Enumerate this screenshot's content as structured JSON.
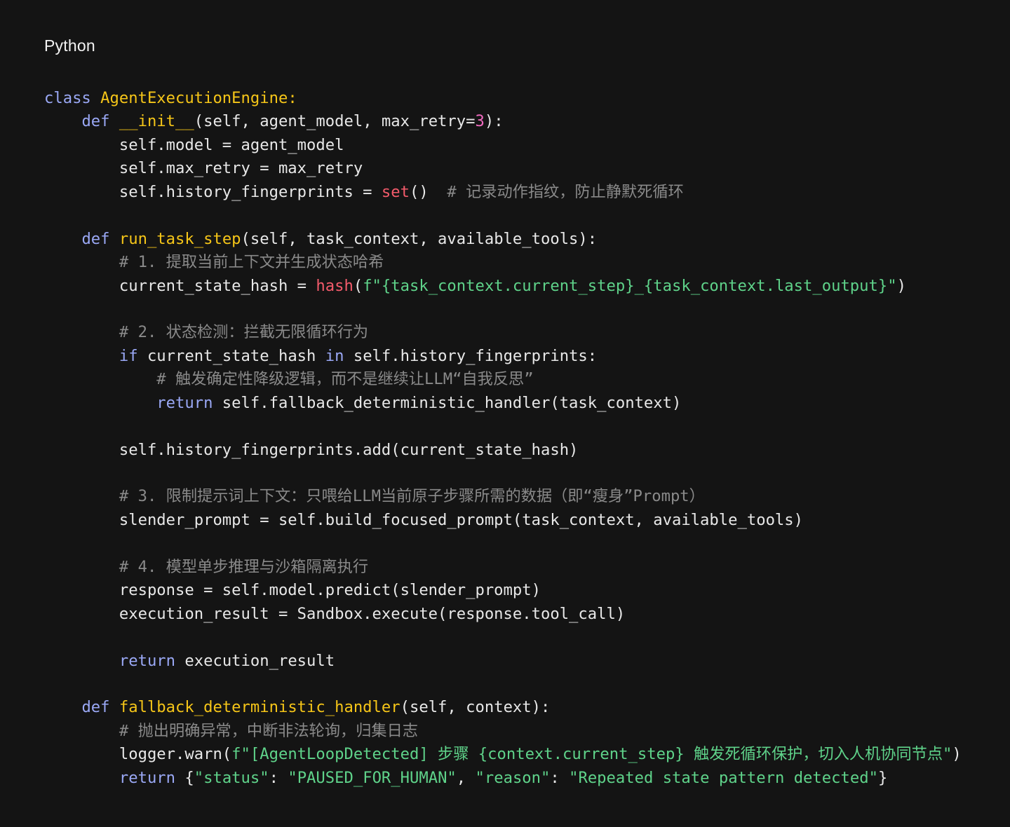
{
  "language_label": "Python",
  "colors": {
    "background": "#141414",
    "keyword": "#9aa8f5",
    "function_name": "#f5c518",
    "number": "#f06abf",
    "builtin": "#f35b6b",
    "string": "#5fd38a",
    "comment": "#8a8a8a",
    "text": "#e8e8e8"
  },
  "code_lines": [
    [
      [
        "kw",
        "class"
      ],
      [
        "plain",
        " "
      ],
      [
        "fn",
        "AgentExecutionEngine:"
      ]
    ],
    [
      [
        "plain",
        "    "
      ],
      [
        "kw",
        "def"
      ],
      [
        "plain",
        " "
      ],
      [
        "fn",
        "__init__"
      ],
      [
        "plain",
        "(self, agent_model, max_retry="
      ],
      [
        "num",
        "3"
      ],
      [
        "plain",
        "):"
      ]
    ],
    [
      [
        "plain",
        "        self.model = agent_model"
      ]
    ],
    [
      [
        "plain",
        "        self.max_retry = max_retry"
      ]
    ],
    [
      [
        "plain",
        "        self.history_fingerprints = "
      ],
      [
        "builtin",
        "set"
      ],
      [
        "plain",
        "()  "
      ],
      [
        "cm",
        "# 记录动作指纹，防止静默死循环"
      ]
    ],
    [],
    [
      [
        "plain",
        "    "
      ],
      [
        "kw",
        "def"
      ],
      [
        "plain",
        " "
      ],
      [
        "fn",
        "run_task_step"
      ],
      [
        "plain",
        "(self, task_context, available_tools):"
      ]
    ],
    [
      [
        "plain",
        "        "
      ],
      [
        "cm",
        "# 1. 提取当前上下文并生成状态哈希"
      ]
    ],
    [
      [
        "plain",
        "        current_state_hash = "
      ],
      [
        "builtin",
        "hash"
      ],
      [
        "plain",
        "("
      ],
      [
        "str",
        "f\"{task_context.current_step}_{task_context.last_output}\""
      ],
      [
        "plain",
        ")"
      ]
    ],
    [],
    [
      [
        "plain",
        "        "
      ],
      [
        "cm",
        "# 2. 状态检测：拦截无限循环行为"
      ]
    ],
    [
      [
        "plain",
        "        "
      ],
      [
        "kw",
        "if"
      ],
      [
        "plain",
        " current_state_hash "
      ],
      [
        "kw",
        "in"
      ],
      [
        "plain",
        " self.history_fingerprints:"
      ]
    ],
    [
      [
        "plain",
        "            "
      ],
      [
        "cm",
        "# 触发确定性降级逻辑，而不是继续让LLM“自我反思”"
      ]
    ],
    [
      [
        "plain",
        "            "
      ],
      [
        "kw",
        "return"
      ],
      [
        "plain",
        " self.fallback_deterministic_handler(task_context)"
      ]
    ],
    [],
    [
      [
        "plain",
        "        self.history_fingerprints.add(current_state_hash)"
      ]
    ],
    [],
    [
      [
        "plain",
        "        "
      ],
      [
        "cm",
        "# 3. 限制提示词上下文：只喂给LLM当前原子步骤所需的数据（即“瘦身”Prompt）"
      ]
    ],
    [
      [
        "plain",
        "        slender_prompt = self.build_focused_prompt(task_context, available_tools)"
      ]
    ],
    [],
    [
      [
        "plain",
        "        "
      ],
      [
        "cm",
        "# 4. 模型单步推理与沙箱隔离执行"
      ]
    ],
    [
      [
        "plain",
        "        response = self.model.predict(slender_prompt)"
      ]
    ],
    [
      [
        "plain",
        "        execution_result = Sandbox.execute(response.tool_call)"
      ]
    ],
    [],
    [
      [
        "plain",
        "        "
      ],
      [
        "kw",
        "return"
      ],
      [
        "plain",
        " execution_result"
      ]
    ],
    [],
    [
      [
        "plain",
        "    "
      ],
      [
        "kw",
        "def"
      ],
      [
        "plain",
        " "
      ],
      [
        "fn",
        "fallback_deterministic_handler"
      ],
      [
        "plain",
        "(self, context):"
      ]
    ],
    [
      [
        "plain",
        "        "
      ],
      [
        "cm",
        "# 抛出明确异常，中断非法轮询，归集日志"
      ]
    ],
    [
      [
        "plain",
        "        logger.warn("
      ],
      [
        "str",
        "f\"[AgentLoopDetected] 步骤 {context.current_step} 触发死循环保护，切入人机协同节点\""
      ],
      [
        "plain",
        ")"
      ]
    ],
    [
      [
        "plain",
        "        "
      ],
      [
        "kw",
        "return"
      ],
      [
        "plain",
        " {"
      ],
      [
        "str",
        "\"status\""
      ],
      [
        "plain",
        ": "
      ],
      [
        "str",
        "\"PAUSED_FOR_HUMAN\""
      ],
      [
        "plain",
        ", "
      ],
      [
        "str",
        "\"reason\""
      ],
      [
        "plain",
        ": "
      ],
      [
        "str",
        "\"Repeated state pattern detected\""
      ],
      [
        "plain",
        "}"
      ]
    ]
  ]
}
